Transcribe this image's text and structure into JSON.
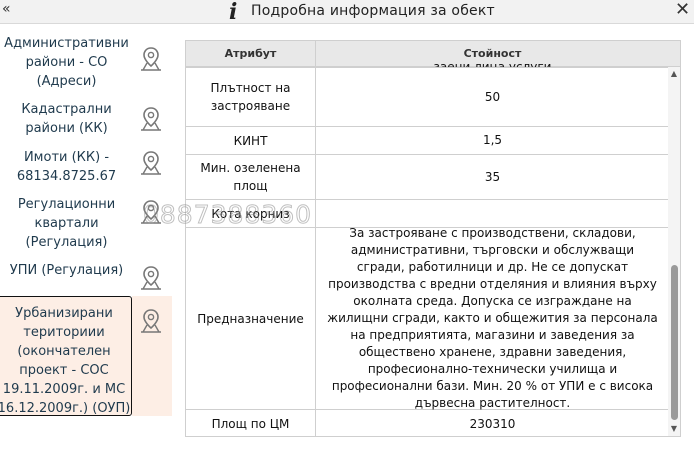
{
  "titlebar": {
    "left_glyph": "«",
    "info_glyph": "i",
    "title": "Подробна информация за обект",
    "close_glyph": "✕"
  },
  "sidebar": {
    "items": [
      {
        "label": "Административни\nрайони - СО\n(Адреси)",
        "icon": "map-pin-icon"
      },
      {
        "label": "Кадастрални\nрайони (КК)",
        "icon": "map-pin-icon"
      },
      {
        "label": "Имоти (КК) -\n68134.8725.67",
        "icon": "map-pin-icon"
      },
      {
        "label": "Регулационни\nквартали\n(Регулация)",
        "icon": "map-pin-icon"
      },
      {
        "label": "УПИ (Регулация)",
        "icon": "map-pin-icon"
      },
      {
        "label": "Урбанизирани\nтериториии\n(окончателен\nпроект - СОС\n19.11.2009г. и МС\n16.12.2009г.) (ОУП)",
        "icon": "map-pin-icon",
        "selected": true
      }
    ]
  },
  "watermark": "0887388360",
  "table": {
    "headers": {
      "attribute": "Атрибут",
      "value": "Стойност"
    },
    "cut_top_text": "заени лица услуги",
    "rows": [
      {
        "attribute": "Плътност на застрояване",
        "value": "50"
      },
      {
        "attribute": "КИНТ",
        "value": "1,5"
      },
      {
        "attribute": "Мин. озеленена площ",
        "value": "35"
      },
      {
        "attribute": "Кота корниз",
        "value": ""
      },
      {
        "attribute": "Предназначение",
        "value": "За застрояване с производствени, складови, административни, търговски и обслужващи сгради, работилници и др. Не се допускат производства с вредни отделяния и влияния върху околната среда. Допуска се изграждане на жилищни сгради, както и общежития за персонала на предприятията, магазини и заведения за обществено хранене, здравни заведения, професионално-технически училища и професионални бази. Мин. 20 % от УПИ е с висока дървесна растителност."
      },
      {
        "attribute": "Площ по ЦМ",
        "value": "230310"
      }
    ]
  },
  "colors": {
    "selected_bg": "#fdeee5",
    "header_bg": "#e8e8e8",
    "scroll_thumb": "#9a9a9a"
  }
}
